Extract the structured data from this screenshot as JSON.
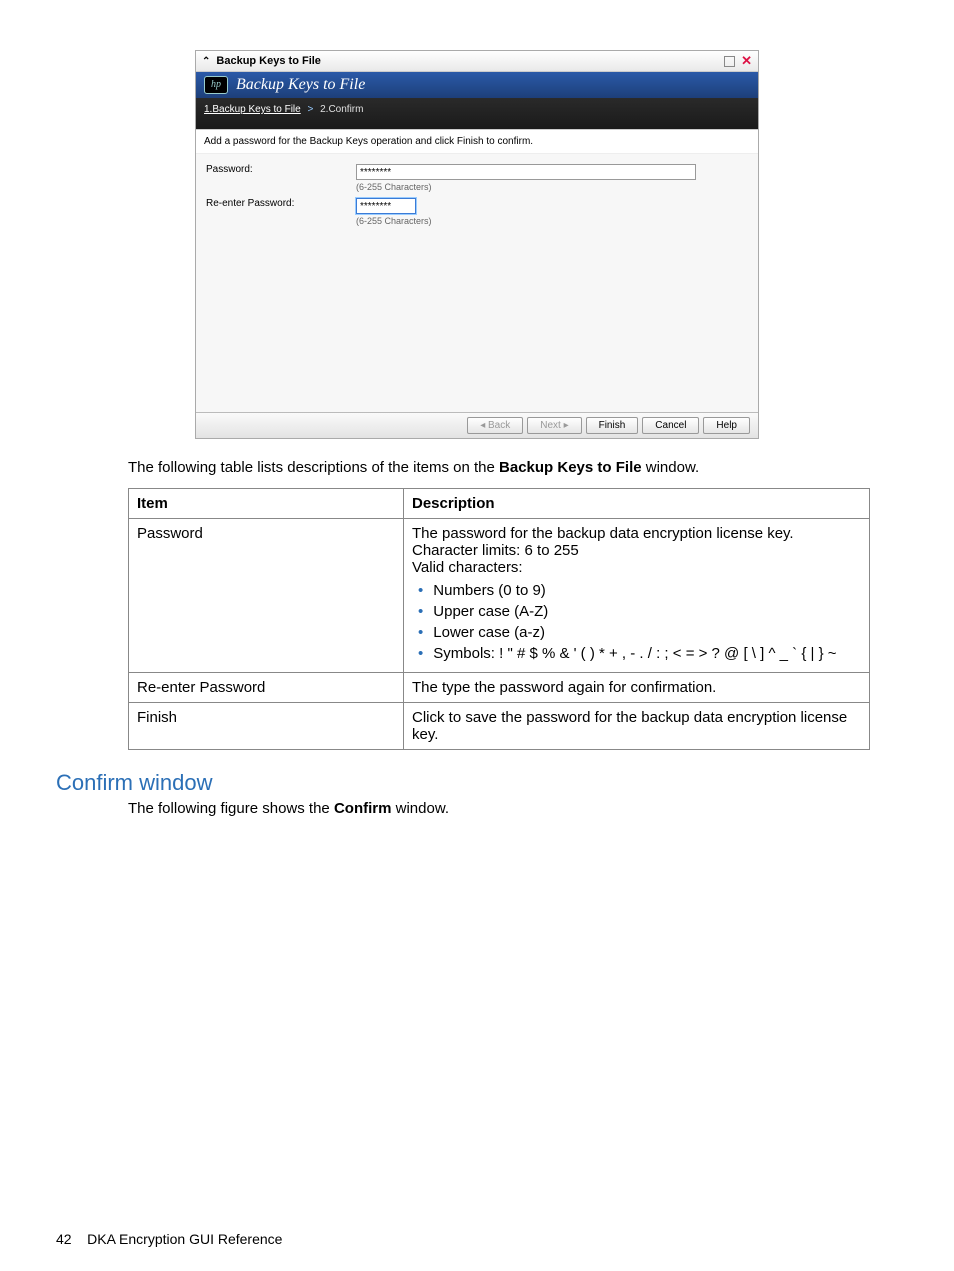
{
  "wizard": {
    "titlebar": "Backup Keys to File",
    "header": "Backup Keys to File",
    "crumb_active": "1.Backup Keys to File",
    "crumb_next": "2.Confirm",
    "instruction": "Add a password for the Backup Keys operation and click Finish to confirm.",
    "pw_label": "Password:",
    "pw_value": "********",
    "pw_hint": "(6-255 Characters)",
    "pw2_label": "Re-enter Password:",
    "pw2_value": "********",
    "pw2_hint": "(6-255 Characters)",
    "buttons": {
      "back": "◂ Back",
      "next": "Next ▸",
      "finish": "Finish",
      "cancel": "Cancel",
      "help": "Help"
    }
  },
  "intro1a": "The following table lists descriptions of the items on the ",
  "intro1b": "Backup Keys to File",
  "intro1c": " window.",
  "table": {
    "h1": "Item",
    "h2": "Description",
    "rows": [
      {
        "item": "Password",
        "desc_lines": [
          "The password for the backup data encryption license key.",
          "Character limits: 6 to 255",
          "Valid characters:"
        ],
        "bullets": [
          "Numbers (0 to 9)",
          "Upper case (A-Z)",
          "Lower case (a-z)",
          "Symbols: ! \" # $ % & ' ( ) * + , - . / : ; < = > ? @ [ \\ ] ^ _ ` { | } ~"
        ]
      },
      {
        "item": "Re-enter Password",
        "desc": "The type the password again for confirmation."
      },
      {
        "item": "Finish",
        "desc": "Click to save the password for the backup data encryption license key."
      }
    ]
  },
  "section_heading": "Confirm window",
  "intro2a": "The following figure shows the ",
  "intro2b": "Confirm",
  "intro2c": " window.",
  "footer_page": "42",
  "footer_text": "DKA Encryption GUI Reference"
}
